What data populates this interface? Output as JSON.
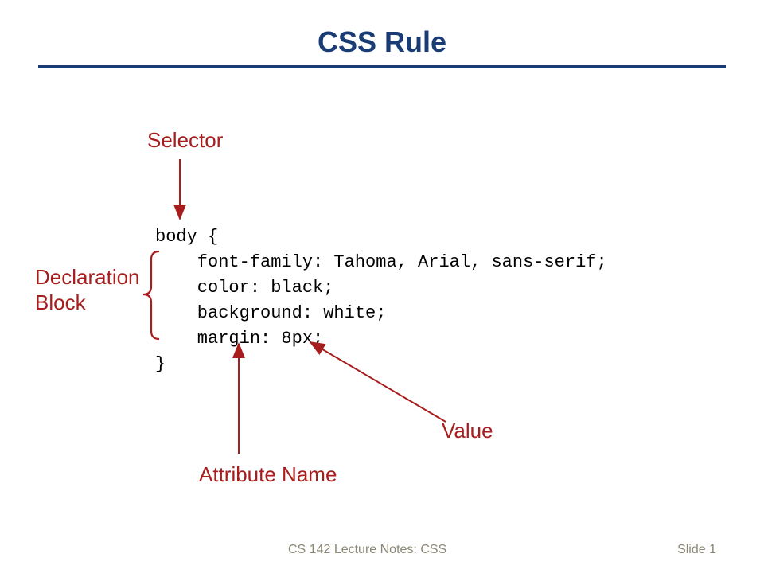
{
  "title": "CSS Rule",
  "labels": {
    "selector": "Selector",
    "declaration_block": "Declaration\nBlock",
    "attribute_name": "Attribute Name",
    "value": "Value"
  },
  "code": "body {\n    font-family: Tahoma, Arial, sans-serif;\n    color: black;\n    background: white;\n    margin: 8px;\n}",
  "footer": {
    "course": "CS 142 Lecture Notes: CSS",
    "slide": "Slide 1"
  },
  "colors": {
    "heading": "#1a3c74",
    "label": "#a81d1d",
    "arrow": "#a81d1d"
  }
}
